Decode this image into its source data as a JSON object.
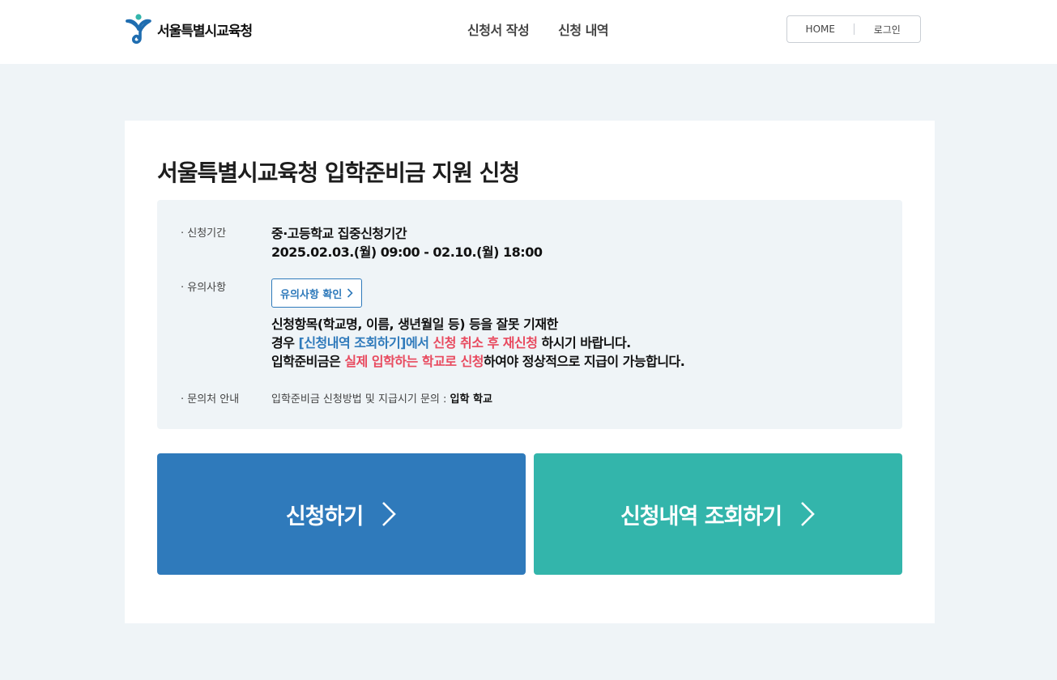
{
  "header": {
    "logo_text": "서울특별시교육청",
    "nav": [
      {
        "label": "신청서 작성"
      },
      {
        "label": "신청 내역"
      }
    ],
    "util": {
      "home": "HOME",
      "login": "로그인"
    }
  },
  "main": {
    "title": "서울특별시교육청 입학준비금 지원 신청",
    "period": {
      "label": "· 신청기간",
      "line1": "중·고등학교 집중신청기간",
      "line2": "2025.02.03.(월) 09:00 - 02.10.(월) 18:00"
    },
    "notice": {
      "label": "· 유의사항",
      "button": "유의사항 확인",
      "line1": "신청항목(학교명, 이름, 생년월일 등) 등을 잘못 기재한",
      "line2_a": "경우 ",
      "line2_b": "[신청내역 조회하기]에서",
      "line2_c": " ",
      "line2_d": "신청 취소 후 재신청",
      "line2_e": " 하시기 바랍니다.",
      "line3_a": "입학준비금은 ",
      "line3_b": "실제 입학하는 학교로 신청",
      "line3_c": "하여야 정상적으로 지급이 가능합니다."
    },
    "contact": {
      "label": "· 문의처 안내",
      "text": "입학준비금 신청방법 및 지급시기 문의 : ",
      "strong": "입학 학교"
    },
    "buttons": {
      "apply": "신청하기",
      "history": "신청내역 조회하기"
    }
  },
  "colors": {
    "primary": "#2f7abb",
    "teal": "#33b5ab",
    "highlight_red": "#e84a5f",
    "background": "#eff4f7"
  }
}
